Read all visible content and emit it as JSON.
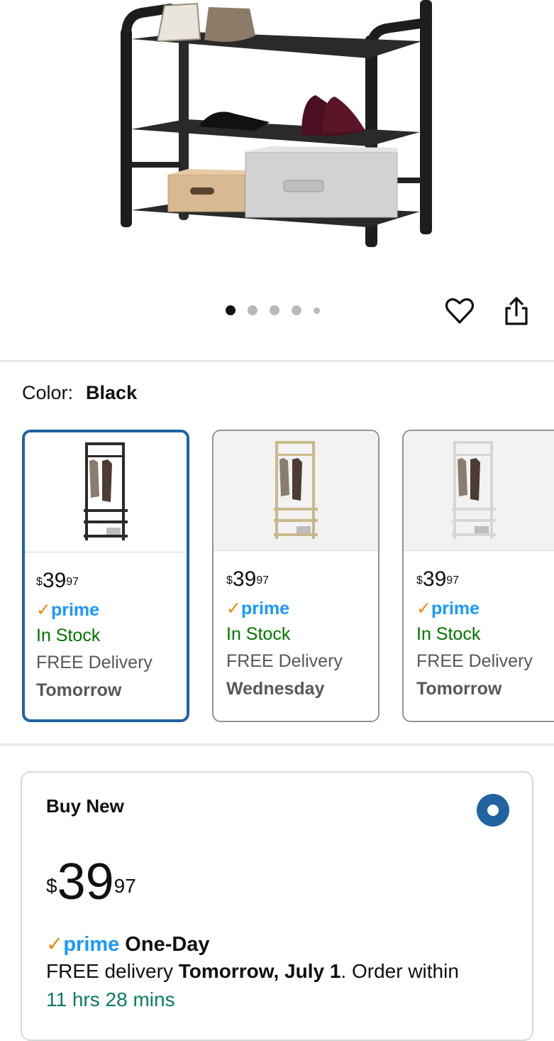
{
  "product_image": {
    "alt": "Black hall tree shoe rack"
  },
  "carousel": {
    "dots": 5,
    "active_index": 0
  },
  "actions": {
    "wishlist_icon": "heart-icon",
    "share_icon": "share-icon"
  },
  "color": {
    "label": "Color:",
    "value": "Black"
  },
  "swatches": [
    {
      "price_whole": "39",
      "price_fraction": "97",
      "currency": "$",
      "prime": "prime",
      "stock": "In Stock",
      "delivery": "FREE Delivery",
      "when": "Tomorrow",
      "frame_color": "#2b2b2b"
    },
    {
      "price_whole": "39",
      "price_fraction": "97",
      "currency": "$",
      "prime": "prime",
      "stock": "In Stock",
      "delivery": "FREE Delivery",
      "when": "Wednesday",
      "frame_color": "#c9b98a"
    },
    {
      "price_whole": "39",
      "price_fraction": "97",
      "currency": "$",
      "prime": "prime",
      "stock": "In Stock",
      "delivery": "FREE Delivery",
      "when": "Tomorrow",
      "frame_color": "#e8e8e8"
    }
  ],
  "buy_box": {
    "title": "Buy New",
    "currency": "$",
    "price_whole": "39",
    "price_fraction": "97",
    "prime_label": "prime",
    "prime_speed": "One-Day",
    "delivery_prefix": "FREE delivery",
    "delivery_date": "Tomorrow, July 1",
    "delivery_suffix": ". Order within",
    "countdown": "11 hrs 28 mins"
  },
  "colors": {
    "accent": "#2162a1",
    "prime_blue": "#1a98ff",
    "in_stock": "#007600",
    "countdown": "#067d62",
    "prime_check": "#f08804"
  }
}
